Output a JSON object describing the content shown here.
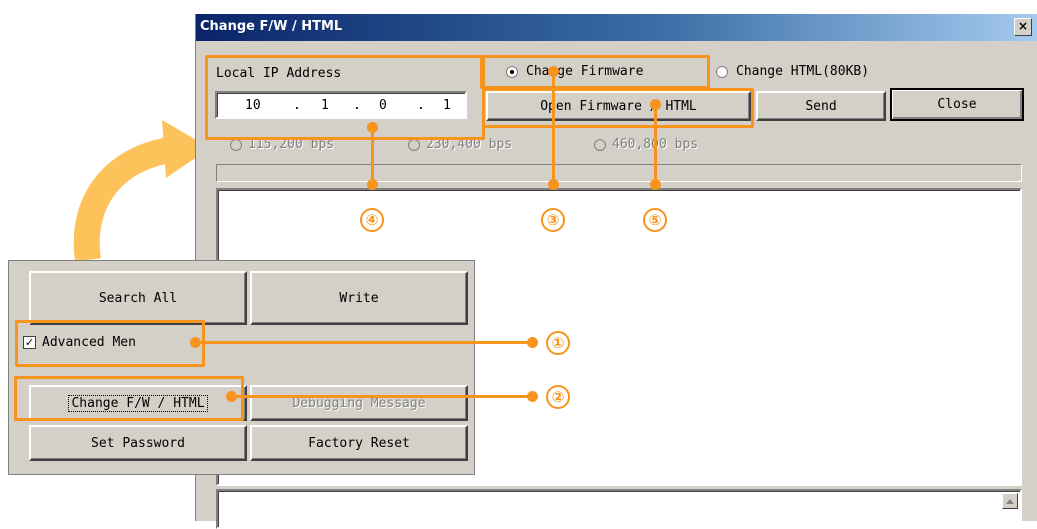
{
  "dialog": {
    "title": "Change F/W / HTML",
    "close_glyph": "×",
    "local_ip_label": "Local IP Address",
    "ip_octets": [
      "10",
      "1",
      "0",
      "1"
    ],
    "ip_separator": ".",
    "radio_firmware_label": "Change Firmware",
    "radio_firmware_selected": true,
    "radio_html_label": "Change HTML(80KB)",
    "open_button_label": "Open Firmware / HTML",
    "send_button_label": "Send",
    "close_button_label": "Close",
    "baud_options": [
      "115,200 bps",
      "230,400 bps",
      "460,800 bps"
    ],
    "baud_enabled": false
  },
  "panel": {
    "search_all_label": "Search All",
    "write_label": "Write",
    "advanced_menu_label": "Advanced Men",
    "advanced_menu_checked": true,
    "check_glyph": "✓",
    "change_fw_label": "Change F/W / HTML",
    "debugging_label": "Debugging Message",
    "set_password_label": "Set Password",
    "factory_reset_label": "Factory Reset"
  },
  "callouts": [
    "①",
    "②",
    "③",
    "④",
    "⑤"
  ],
  "colors": {
    "accent": "#f7941d",
    "dialog_bg": "#d4d0c8",
    "titlebar": "#0a246a"
  },
  "icons": [
    "curved-arrow-icon",
    "close-icon",
    "scroll-up-arrow-icon"
  ]
}
